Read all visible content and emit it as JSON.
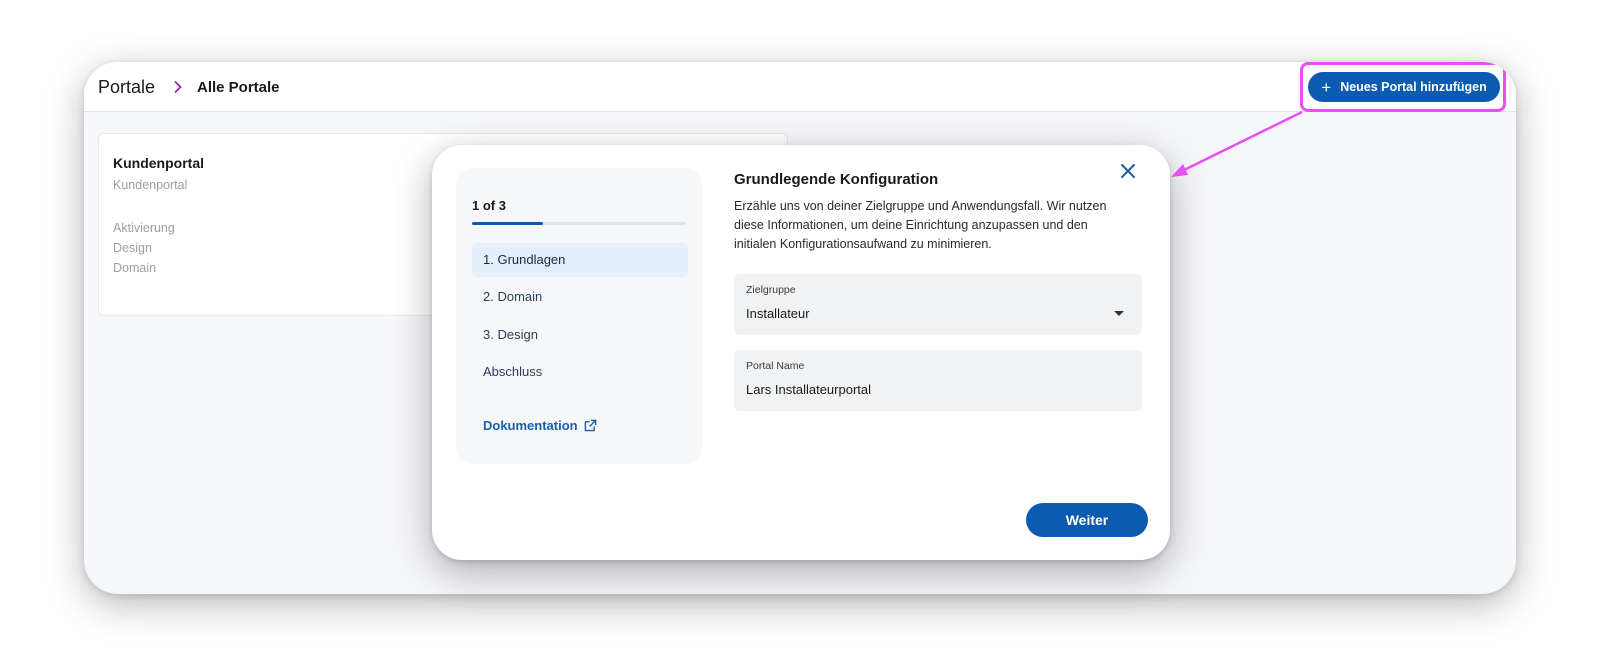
{
  "header": {
    "breadcrumb_root": "Portale",
    "breadcrumb_current": "Alle Portale",
    "add_button_label": "Neues Portal hinzufügen"
  },
  "card": {
    "title": "Kundenportal",
    "subtitle": "Kundenportal",
    "links": [
      "Aktivierung",
      "Design",
      "Domain"
    ]
  },
  "modal": {
    "step_counter": "1 of 3",
    "progress": 0.33,
    "steps": [
      "1. Grundlagen",
      "2. Domain",
      "3. Design",
      "Abschluss"
    ],
    "active_step": 0,
    "doc_link": "Dokumentation",
    "title": "Grundlegende Konfiguration",
    "description": "Erzähle uns von deiner Zielgruppe und Anwendungsfall. Wir nutzen diese Informationen, um deine Einrichtung anzupassen und den initialen Konfigurationsaufwand zu minimieren.",
    "fields": {
      "audience_label": "Zielgruppe",
      "audience_value": "Installateur",
      "portal_name_label": "Portal Name",
      "portal_name_value": "Lars Installateurportal"
    },
    "next_label": "Weiter"
  },
  "colors": {
    "accent": "#0d5bb0",
    "highlight": "#e94ef2"
  },
  "icons": [
    "chevron-right-icon",
    "plus-icon",
    "close-icon",
    "external-link-icon",
    "caret-down-icon"
  ]
}
